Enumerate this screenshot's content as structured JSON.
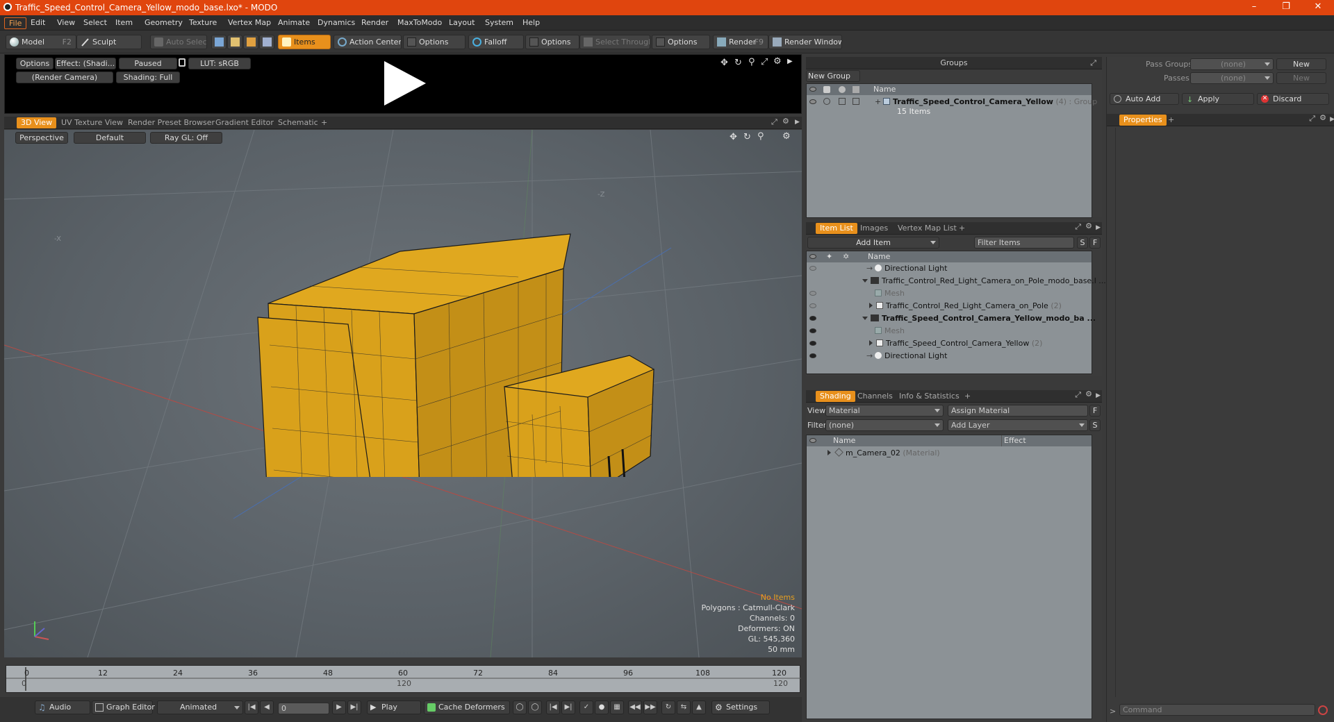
{
  "window": {
    "title": "Traffic_Speed_Control_Camera_Yellow_modo_base.lxo* - MODO"
  },
  "menu": [
    "File",
    "Edit",
    "View",
    "Select",
    "Item",
    "Geometry",
    "Texture",
    "Vertex Map",
    "Animate",
    "Dynamics",
    "Render",
    "MaxToModo",
    "Layout",
    "System",
    "Help"
  ],
  "toolbar": {
    "model": "Model",
    "model_key": "F2",
    "sculpt": "Sculpt",
    "auto_select": "Auto Select",
    "items": "Items",
    "action_center": "Action Center",
    "options1": "Options",
    "falloff": "Falloff",
    "options2": "Options",
    "select_through": "Select Through",
    "options3": "Options",
    "render": "Render",
    "render_key": "F9",
    "render_window": "Render Window"
  },
  "preview": {
    "options": "Options",
    "effect": "Effect: (Shadi...",
    "paused": "Paused",
    "lut": "LUT: sRGB",
    "camera": "(Render Camera)",
    "shading": "Shading: Full"
  },
  "viewport_tabs": [
    "3D View",
    "UV Texture View",
    "Render Preset Browser",
    "Gradient Editor",
    "Schematic",
    "+"
  ],
  "viewport": {
    "perspective": "Perspective",
    "default": "Default",
    "raygl": "Ray GL: Off",
    "axis_z": "-Z",
    "axis_x": "-X"
  },
  "hud": {
    "no_items": "No Items",
    "polygons": "Polygons : Catmull-Clark",
    "channels": "Channels: 0",
    "deformers": "Deformers: ON",
    "gl": "GL: 545,360",
    "focal": "50 mm"
  },
  "timeline": {
    "ticks": [
      "0",
      "12",
      "24",
      "36",
      "48",
      "60",
      "72",
      "84",
      "96",
      "108",
      "120"
    ],
    "sub_start": "0",
    "sub_mid": "120",
    "sub_end": "120"
  },
  "bottombar": {
    "audio": "Audio",
    "graph": "Graph Editor",
    "animated": "Animated",
    "frame": "0",
    "play": "Play",
    "cache": "Cache Deformers",
    "settings": "Settings"
  },
  "groups": {
    "title": "Groups",
    "new_group": "New Group",
    "col_name": "Name",
    "group_name": "Traffic_Speed_Control_Camera_Yellow",
    "group_count": "(4)",
    "group_type": ": Group",
    "group_items": "15 Items"
  },
  "itemlist": {
    "tabs": [
      "Item List",
      "Images",
      "Vertex Map List",
      "+"
    ],
    "add_item": "Add Item",
    "filter": "Filter Items",
    "s": "S",
    "f": "F",
    "col_name": "Name",
    "rows": [
      "Directional Light",
      "Traffic_Control_Red_Light_Camera_on_Pole_modo_base.l ...",
      "Mesh",
      "Traffic_Control_Red_Light_Camera_on_Pole",
      "(2)",
      "Traffic_Speed_Control_Camera_Yellow_modo_ba ...",
      "Mesh",
      "Traffic_Speed_Control_Camera_Yellow",
      "(2)",
      "Directional Light"
    ]
  },
  "shading": {
    "tabs": [
      "Shading",
      "Channels",
      "Info & Statistics",
      "+"
    ],
    "view_label": "View",
    "view_value": "Material",
    "assign": "Assign Material",
    "filter_label": "Filter",
    "filter_value": "(none)",
    "add_layer": "Add Layer",
    "col_name": "Name",
    "col_effect": "Effect",
    "mat_name": "m_Camera_02",
    "mat_type": "(Material)",
    "f": "F",
    "s": "S"
  },
  "right": {
    "pass_groups": "Pass Groups",
    "passes": "Passes",
    "none1": "(none)",
    "none2": "(none)",
    "new1": "New",
    "new2": "New",
    "auto_add": "Auto Add",
    "apply": "Apply",
    "discard": "Discard",
    "properties": "Properties",
    "plus": "+",
    "command": "Command"
  },
  "colors": {
    "accent": "#e8901c",
    "titlebar": "#e0450e",
    "model_yellow": "#e8b020"
  }
}
